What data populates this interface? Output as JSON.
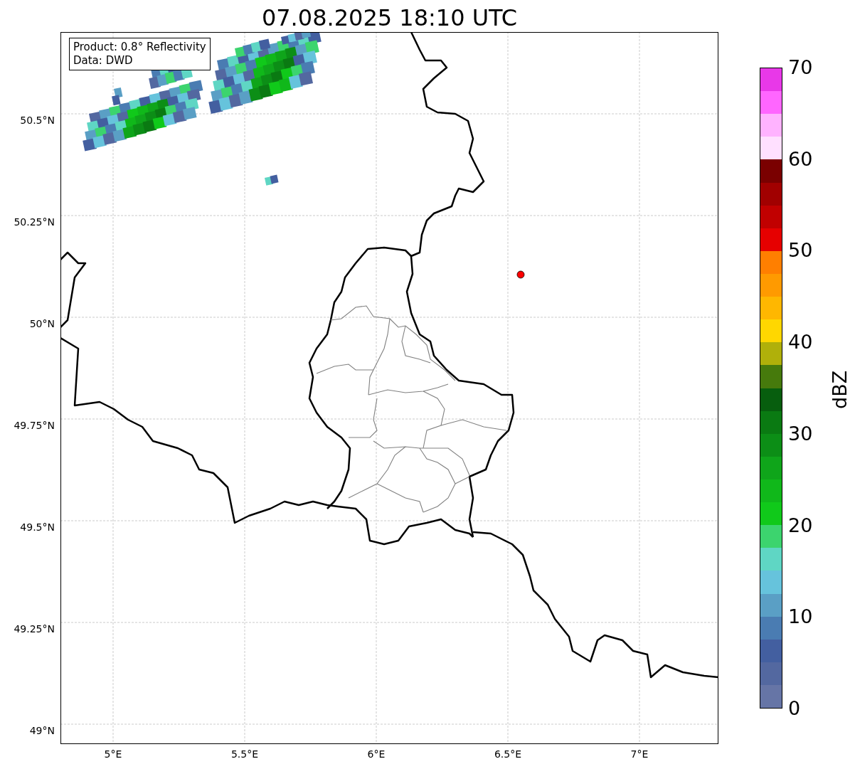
{
  "title": "07.08.2025 18:10 UTC",
  "map": {
    "info_lines": [
      "Product: 0.8° Reflectivity",
      "Data: DWD"
    ],
    "yticks": [
      "50.5°N",
      "50.25°N",
      "50°N",
      "49.75°N",
      "49.5°N",
      "49.25°N",
      "49°N"
    ],
    "xticks": [
      "5°E",
      "5.5°E",
      "6°E",
      "6.5°E",
      "7°E"
    ],
    "marker": {
      "color": "#ff0000"
    }
  },
  "colorbar": {
    "label": "dBZ",
    "ticks": [
      "70",
      "60",
      "50",
      "40",
      "30",
      "20",
      "10",
      "0"
    ],
    "bands": [
      {
        "color": "#e838e8"
      },
      {
        "color": "#ff66ff"
      },
      {
        "color": "#ffb3ff"
      },
      {
        "color": "#ffe0ff"
      },
      {
        "color": "#7a0000"
      },
      {
        "color": "#a10000"
      },
      {
        "color": "#c10000"
      },
      {
        "color": "#e60000"
      },
      {
        "color": "#ff7f00"
      },
      {
        "color": "#ff9a00"
      },
      {
        "color": "#ffb700"
      },
      {
        "color": "#ffd700"
      },
      {
        "color": "#b0b00a"
      },
      {
        "color": "#467a0c"
      },
      {
        "color": "#075e0e"
      },
      {
        "color": "#0a7a12"
      },
      {
        "color": "#0c8e16"
      },
      {
        "color": "#0fa51a"
      },
      {
        "color": "#10b81a"
      },
      {
        "color": "#10c91a"
      },
      {
        "color": "#3cd46e"
      },
      {
        "color": "#5fd6c4"
      },
      {
        "color": "#66c3dc"
      },
      {
        "color": "#5a9fc5"
      },
      {
        "color": "#4a7cb2"
      },
      {
        "color": "#435fa0"
      },
      {
        "color": "#5368a0"
      },
      {
        "color": "#6675a6"
      }
    ]
  }
}
